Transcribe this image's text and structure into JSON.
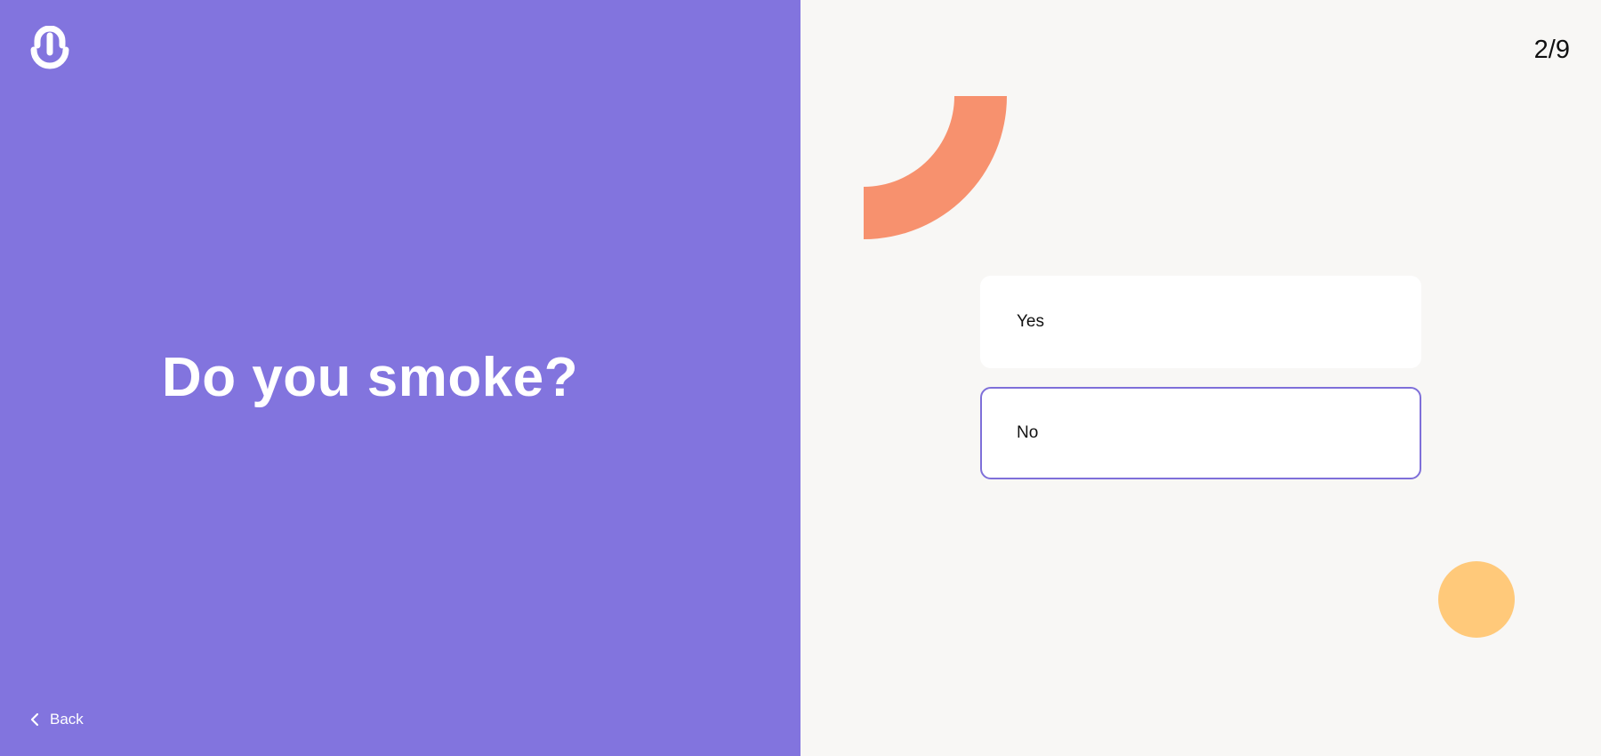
{
  "question": "Do you smoke?",
  "progress": "2/9",
  "back_label": "Back",
  "options": [
    {
      "label": "Yes",
      "selected": false
    },
    {
      "label": "No",
      "selected": true
    }
  ],
  "icons": {
    "logo": "logo-icon",
    "back": "chevron-left-icon"
  },
  "colors": {
    "left_panel": "#8274de",
    "right_panel": "#f8f7f5",
    "selected_border": "#7e6fd9",
    "deco_arc": "#f7916e",
    "deco_circle": "#ffc97a"
  }
}
